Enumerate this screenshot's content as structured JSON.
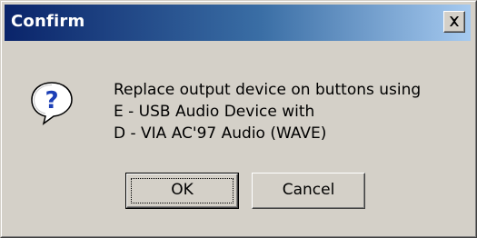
{
  "window": {
    "title": "Confirm",
    "close_icon": "close-x-icon"
  },
  "dialog": {
    "icon": "question-icon",
    "message_lines": [
      "Replace output device on buttons using",
      "E - USB Audio Device with",
      "D - VIA AC'97 Audio (WAVE)"
    ]
  },
  "buttons": {
    "ok_label": "OK",
    "cancel_label": "Cancel"
  },
  "colors": {
    "titlebar_start": "#0a246a",
    "titlebar_end": "#a6caf0",
    "face": "#d4d0c8",
    "icon_blue": "#1c3fb6"
  }
}
